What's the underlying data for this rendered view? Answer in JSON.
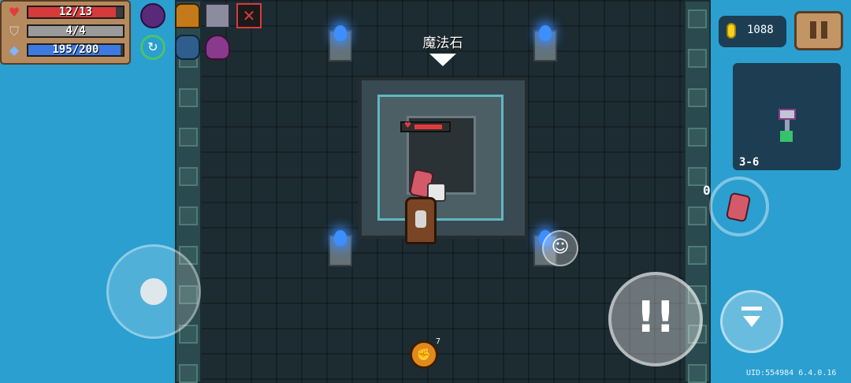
{
  "player_stats": {
    "health": {
      "text": "12/13",
      "icon": "heart-icon",
      "color": "#e23b3b",
      "fraction": 0.923
    },
    "armor": {
      "text": "4/4",
      "icon": "shield-icon",
      "color": "#a8a8a8",
      "fraction": 1.0
    },
    "energy": {
      "text": "195/200",
      "icon": "diamond-icon",
      "color": "#3d7ae0",
      "fraction": 0.975
    }
  },
  "buffs": [
    "demon-helmet-icon",
    "armor-knight-icon",
    "skeleton-buff-icon",
    "cancelled-buff-icon",
    "spin-buff-icon",
    "ghost-buff-icon",
    "octopus-buff-icon"
  ],
  "coins": "1088",
  "level": "3-6",
  "altar_label": "魔法石",
  "weapon_swap_count": "0",
  "uid_version": "UID:554984 6.4.0.16",
  "colors": {
    "background": "#2a9fd0",
    "floor": "#1d2c33",
    "altar_trim": "#5fb7c3",
    "flame": "#3d8eff",
    "coin": "#f5d21b"
  },
  "enemy_hp_fraction": 0.8,
  "bomb_count": "7"
}
